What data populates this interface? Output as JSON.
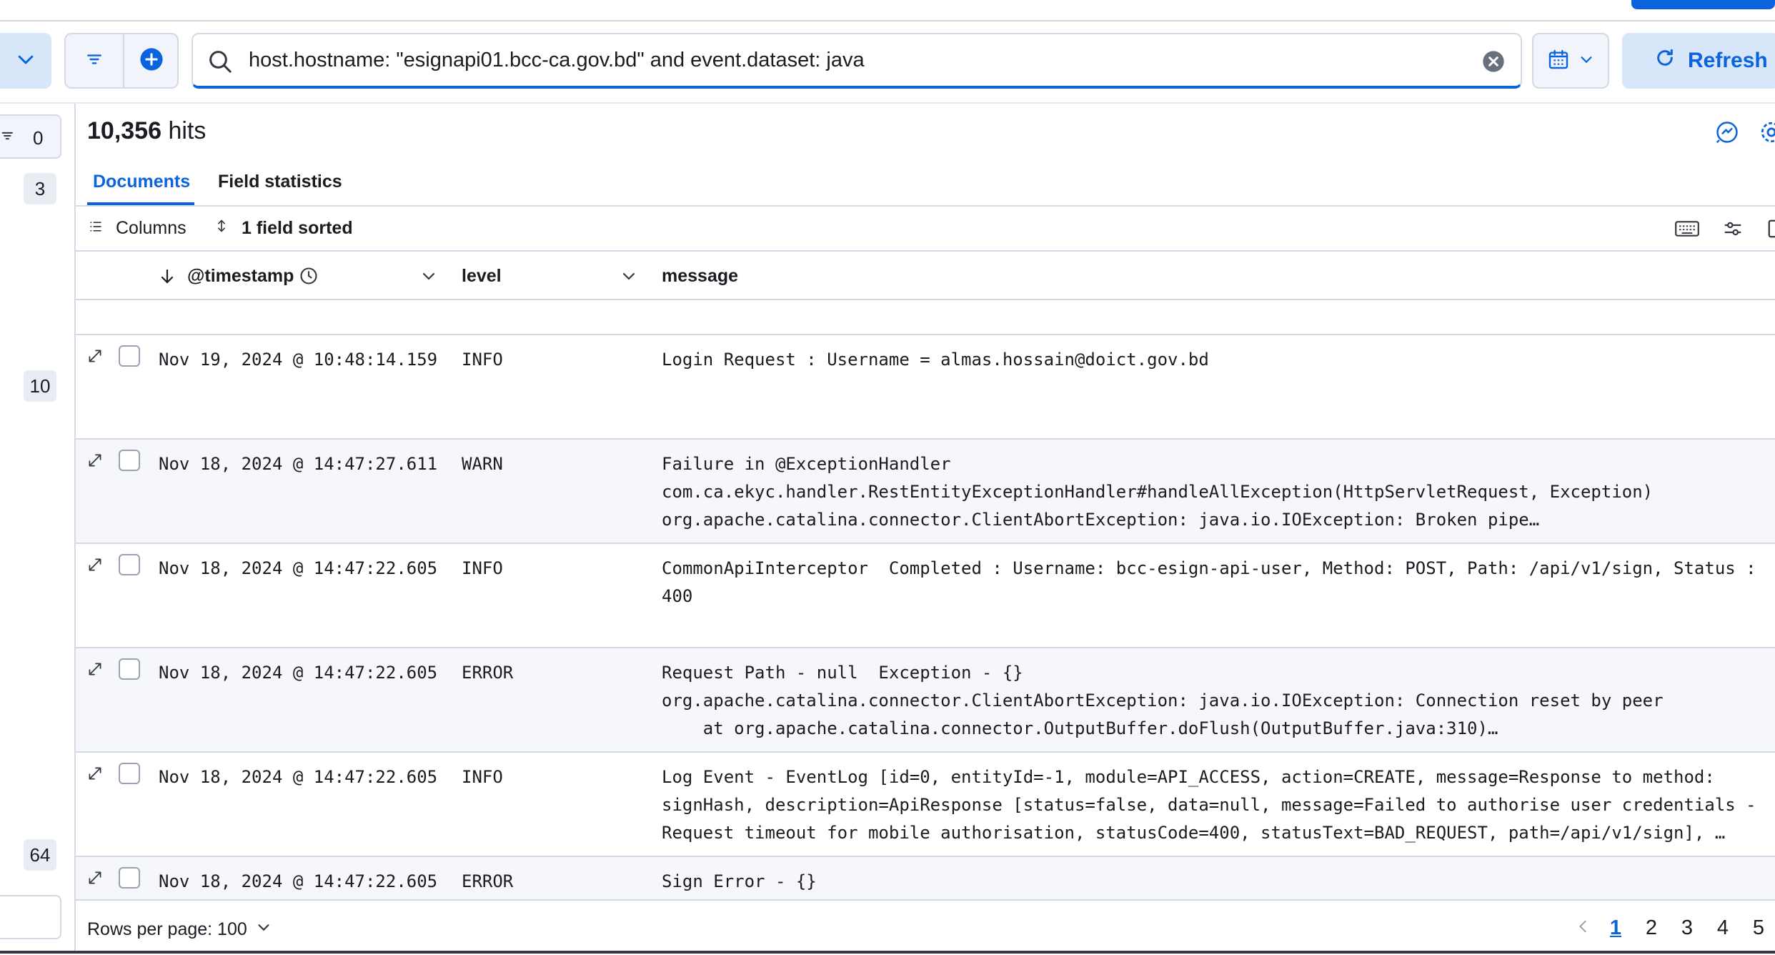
{
  "query": {
    "text": "host.hostname: \"esignapi01.bcc-ca.gov.bd\" and event.dataset: java",
    "refresh_label": "Refresh"
  },
  "sidebar": {
    "filter_count": "0",
    "field_counts": [
      "3",
      "10",
      "64"
    ]
  },
  "summary": {
    "hits_count": "10,356",
    "hits_label": "hits"
  },
  "tabs": [
    {
      "label": "Documents"
    },
    {
      "label": "Field statistics"
    }
  ],
  "toolbar": {
    "columns_label": "Columns",
    "sort_label": "1 field sorted"
  },
  "columns": [
    {
      "label": "@timestamp"
    },
    {
      "label": "level"
    },
    {
      "label": "message"
    }
  ],
  "rows": [
    {
      "timestamp": "Nov 19, 2024 @ 10:48:14.159",
      "level": "INFO",
      "message": [
        "Login Request : Username = almas.hossain@doict.gov.bd"
      ]
    },
    {
      "timestamp": "Nov 18, 2024 @ 14:47:27.611",
      "level": "WARN",
      "message": [
        "Failure in @ExceptionHandler",
        "com.ca.ekyc.handler.RestEntityExceptionHandler#handleAllException(HttpServletRequest, Exception)",
        "org.apache.catalina.connector.ClientAbortException: java.io.IOException: Broken pipe…"
      ]
    },
    {
      "timestamp": "Nov 18, 2024 @ 14:47:22.605",
      "level": "INFO",
      "message": [
        "CommonApiInterceptor  Completed : Username: bcc-esign-api-user, Method: POST, Path: /api/v1/sign, Status :",
        "400"
      ]
    },
    {
      "timestamp": "Nov 18, 2024 @ 14:47:22.605",
      "level": "ERROR",
      "message": [
        "Request Path - null  Exception - {}",
        "org.apache.catalina.connector.ClientAbortException: java.io.IOException: Connection reset by peer",
        "    at org.apache.catalina.connector.OutputBuffer.doFlush(OutputBuffer.java:310)…"
      ]
    },
    {
      "timestamp": "Nov 18, 2024 @ 14:47:22.605",
      "level": "INFO",
      "message": [
        "Log Event - EventLog [id=0, entityId=-1, module=API_ACCESS, action=CREATE, message=Response to method:",
        "signHash, description=ApiResponse [status=false, data=null, message=Failed to authorise user credentials -",
        "Request timeout for mobile authorisation, statusCode=400, statusText=BAD_REQUEST, path=/api/v1/sign], …"
      ]
    },
    {
      "timestamp": "Nov 18, 2024 @ 14:47:22.605",
      "level": "ERROR",
      "message": [
        "Sign Error - {}"
      ]
    }
  ],
  "footer": {
    "rows_per_page_label": "Rows per page: 100",
    "pages": [
      "1",
      "2",
      "3",
      "4",
      "5"
    ],
    "active_page": "1"
  }
}
